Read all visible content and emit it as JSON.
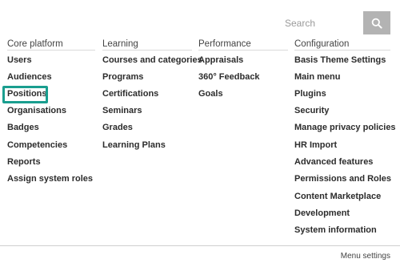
{
  "search": {
    "placeholder": "Search"
  },
  "columns": [
    {
      "heading": "Core platform",
      "items": [
        "Users",
        "Audiences",
        "Positions",
        "Organisations",
        "Badges",
        "Competencies",
        "Reports",
        "Assign system roles"
      ]
    },
    {
      "heading": "Learning",
      "items": [
        "Courses and categories",
        "Programs",
        "Certifications",
        "Seminars",
        "Grades",
        "Learning Plans"
      ]
    },
    {
      "heading": "Performance",
      "items": [
        "Appraisals",
        "360° Feedback",
        "Goals"
      ]
    },
    {
      "heading": "Configuration",
      "items": [
        "Basis Theme Settings",
        "Main menu",
        "Plugins",
        "Security",
        "Manage privacy policies",
        "HR Import",
        "Advanced features",
        "Permissions and Roles",
        "Content Marketplace",
        "Development",
        "System information"
      ]
    }
  ],
  "footer": {
    "menu_settings": "Menu settings"
  },
  "highlighted_item": "Positions",
  "colors": {
    "highlight": "#1a9e8f",
    "search_button": "#b3b3b3"
  }
}
